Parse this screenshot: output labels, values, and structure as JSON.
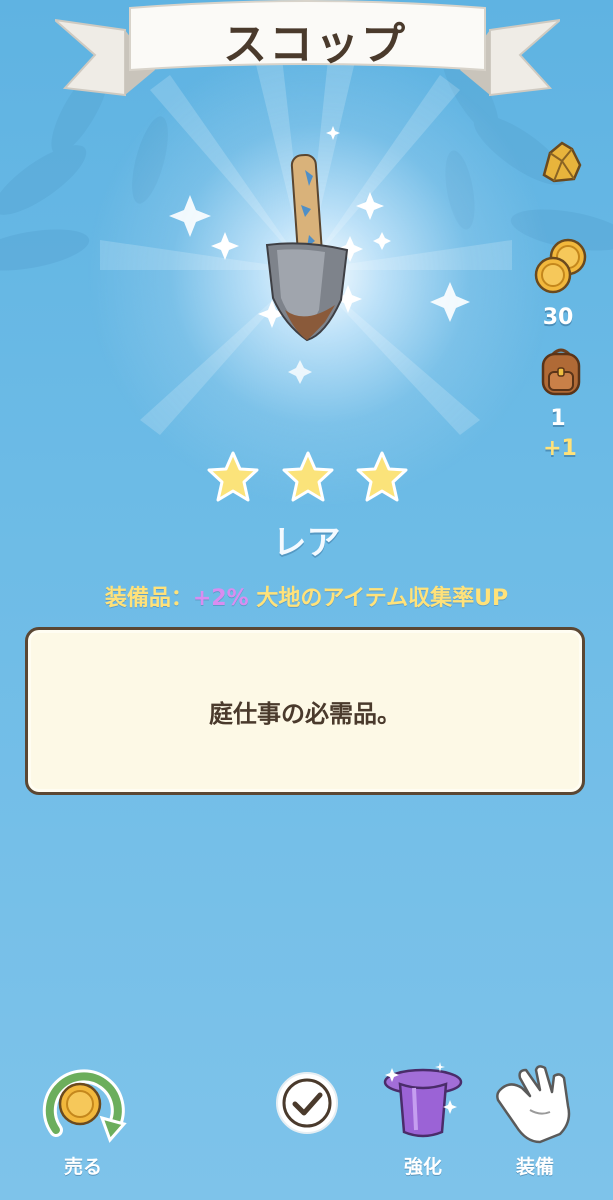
{
  "title": "スコップ",
  "item": {
    "name": "shovel",
    "stars": 3
  },
  "resources": {
    "gold_icon": "gold-nugget-icon",
    "coins": "30",
    "bag_count": "1",
    "bag_bonus": "+1"
  },
  "rarity": "レア",
  "effect": {
    "label": "装備品：",
    "percent": "+2%",
    "text": "大地のアイテム収集率UP"
  },
  "description": "庭仕事の必需品。",
  "actions": {
    "sell": "売る",
    "enhance": "強化",
    "equip": "装備"
  },
  "colors": {
    "background": "#6cbbe6",
    "title_text": "#4a3a2c",
    "effect_label": "#ffe27a",
    "effect_percent": "#d98df0",
    "panel": "#fdf9e6"
  }
}
